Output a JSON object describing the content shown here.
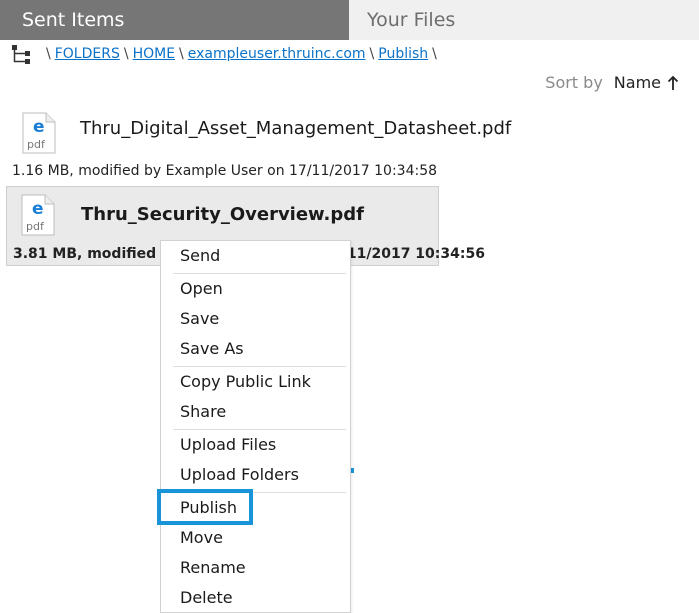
{
  "tabs": {
    "sent_items": "Sent Items",
    "your_files": "Your Files"
  },
  "breadcrumb": {
    "sep": "\\",
    "items": [
      "FOLDERS",
      "HOME",
      "exampleuser.thruinc.com",
      "Publish"
    ]
  },
  "sort": {
    "label": "Sort by",
    "value": "Name",
    "direction": "ascending"
  },
  "files": [
    {
      "icon": "pdf-icon",
      "icon_text": "pdf",
      "name": "Thru_Digital_Asset_Management_Datasheet.pdf",
      "meta": "1.16 MB, modified by Example User on 17/11/2017 10:34:58"
    },
    {
      "icon": "pdf-icon",
      "icon_text": "pdf",
      "name": "Thru_Security_Overview.pdf",
      "meta": "3.81 MB, modified by Example User on 17/11/2017 10:34:56"
    }
  ],
  "context_menu": {
    "items": [
      "Send",
      "Open",
      "Save",
      "Save As",
      "Copy Public Link",
      "Share",
      "Upload Files",
      "Upload Folders",
      "Publish",
      "Move",
      "Rename",
      "Delete"
    ],
    "highlighted": "Publish"
  },
  "colors": {
    "tab_active_bg": "#767676",
    "tab_inactive_bg": "#f0f0f0",
    "link": "#0a72c9",
    "highlight": "#1a94d8",
    "selected_row_bg": "#eaeaea"
  }
}
